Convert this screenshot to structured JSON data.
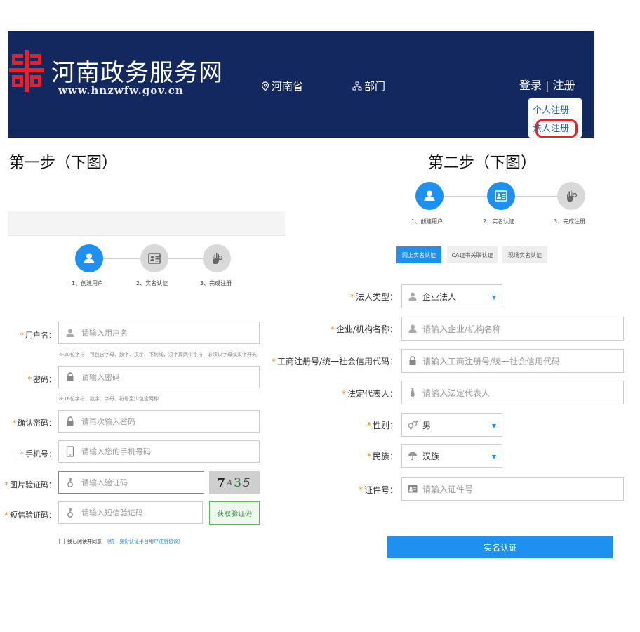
{
  "header": {
    "site_title": "河南政务服务网",
    "site_url": "www.hnzwfw.gov.cn",
    "region_label": "河南省",
    "dept_label": "部门",
    "login_label": "登录",
    "auth_separator": "|",
    "register_label": "注册",
    "dropdown": {
      "personal_register": "个人注册",
      "legal_register": "法人注册"
    },
    "banner_color": "#12285f",
    "logo_color": "#e8202a"
  },
  "captions": {
    "step_one": "第一步（下图）",
    "step_two": "第二步（下图）"
  },
  "steps_left": [
    {
      "label": "1、创建用户",
      "active": true
    },
    {
      "label": "2、实名认证",
      "active": false
    },
    {
      "label": "3、完成注册",
      "active": false
    }
  ],
  "steps_right": [
    {
      "label": "1、创建用户",
      "active": true
    },
    {
      "label": "2、实名认证",
      "active": true
    },
    {
      "label": "3、完成注册",
      "active": false
    }
  ],
  "left_form": {
    "required_mark": "*",
    "username": {
      "label": "用户名：",
      "placeholder": "请输入用户名",
      "hint": "4-20位字符，可包含字母、数字、汉字、下划线，汉字算两个字符，必须以字母或汉字开头"
    },
    "password": {
      "label": "密码：",
      "placeholder": "请输入密码",
      "hint": "8-16位字符，数字、字母、符号至少包含两种"
    },
    "confirm_password": {
      "label": "确认密码：",
      "placeholder": "请再次输入密码"
    },
    "phone": {
      "label": "手机号：",
      "placeholder": "请输入您的手机号码"
    },
    "image_code": {
      "label": "图片验证码：",
      "placeholder": "请输入验证码",
      "captcha": [
        "7",
        "A",
        "3",
        "5"
      ]
    },
    "sms_code": {
      "label": "短信验证码：",
      "placeholder": "请输入短信验证码",
      "button": "获取验证码"
    },
    "agreement": {
      "text": "我已阅读并同意",
      "link": "《统一身份认证平台用户注册协议》"
    }
  },
  "right_form": {
    "tabs": [
      "网上实名认证",
      "CA证书关联认证",
      "现场实名认证"
    ],
    "legal_type": {
      "label": "法人类型：",
      "value": "企业法人"
    },
    "org_name": {
      "label": "企业/机构名称：",
      "placeholder": "请输入企业/机构名称"
    },
    "reg_no": {
      "label": "工商注册号/统一社会信用代码：",
      "placeholder": "请输入工商注册号/统一社会信用代码"
    },
    "legal_rep": {
      "label": "法定代表人：",
      "placeholder": "请输入法定代表人"
    },
    "gender": {
      "label": "性别：",
      "value": "男"
    },
    "ethnicity": {
      "label": "民族：",
      "value": "汉族"
    },
    "id_no": {
      "label": "证件号：",
      "placeholder": "请输入证件号"
    },
    "submit": "实名认证"
  },
  "colors": {
    "accent": "#1e90f0",
    "required": "#f08a00",
    "highlight_ring": "#e8202a"
  }
}
